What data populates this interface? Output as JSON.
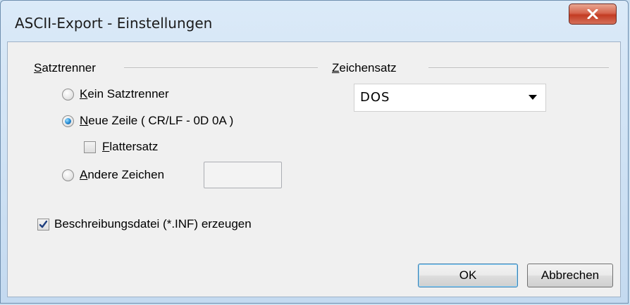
{
  "window": {
    "title": "ASCII-Export - Einstellungen",
    "close_icon": "close-icon"
  },
  "record_separator": {
    "group_label": "Satztrenner",
    "options": [
      {
        "label": "Kein Satztrenner",
        "selected": false
      },
      {
        "label": "Neue Zeile ( CR/LF - 0D 0A )",
        "selected": true
      },
      {
        "label": "Andere Zeichen",
        "selected": false
      }
    ],
    "flattersatz_label": "Flattersatz",
    "flattersatz_checked": false,
    "other_chars_value": ""
  },
  "charset": {
    "group_label": "Zeichensatz",
    "selected_value": "DOS"
  },
  "description_file": {
    "label": "Beschreibungsdatei (*.INF) erzeugen",
    "checked": true
  },
  "buttons": {
    "ok_label": "OK",
    "cancel_label": "Abbrechen"
  }
}
